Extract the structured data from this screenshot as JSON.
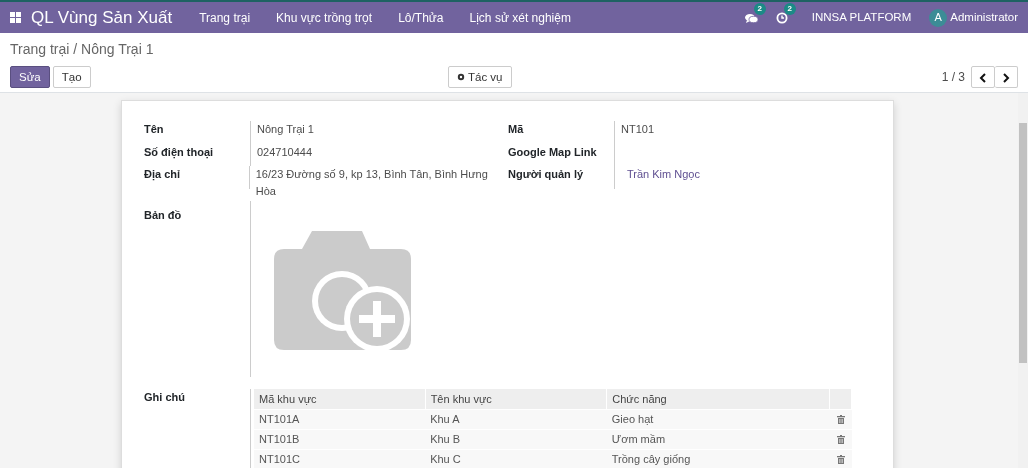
{
  "app": {
    "title": "QL Vùng Sản Xuất",
    "menu": [
      "Trang trại",
      "Khu vực trồng trọt",
      "Lô/Thửa",
      "Lịch sử xét nghiệm"
    ],
    "messages_count": "2",
    "activities_count": "2",
    "company": "INNSA PLATFORM",
    "user": {
      "initial": "A",
      "name": "Administrator"
    }
  },
  "breadcrumb": "Trang trại / Nông Trại 1",
  "buttons": [
    {
      "label": "Sửa",
      "primary": true
    },
    {
      "label": "Tạo",
      "primary": false
    }
  ],
  "action_button": "Tác vụ",
  "pager": "1 / 3",
  "fields_left": [
    {
      "label": "Tên",
      "value": "Nông Trại 1"
    },
    {
      "label": "Số điện thoại",
      "value": "024710444"
    },
    {
      "label": "Địa chỉ",
      "value": "16/23 Đường số 9, kp 13, Bình Tân, Bình Hưng Hòa"
    }
  ],
  "fields_right": [
    {
      "label": "Mã",
      "value": "NT101",
      "kind": "text"
    },
    {
      "label": "Google Map Link"
    },
    {
      "label": "Người quản lý",
      "value": "Trần Kim Ngọc",
      "kind": "link"
    }
  ],
  "map_label": "Bản đồ",
  "notes_label": "Ghi chú",
  "table": {
    "columns": [
      "Mã khu vực",
      "Tên khu vực",
      "Chức năng"
    ],
    "rows": [
      [
        "NT101A",
        "Khu A",
        "Gieo hạt"
      ],
      [
        "NT101B",
        "Khu B",
        "Ươm mầm"
      ],
      [
        "NT101C",
        "Khu C",
        "Trồng cây giống"
      ]
    ]
  }
}
